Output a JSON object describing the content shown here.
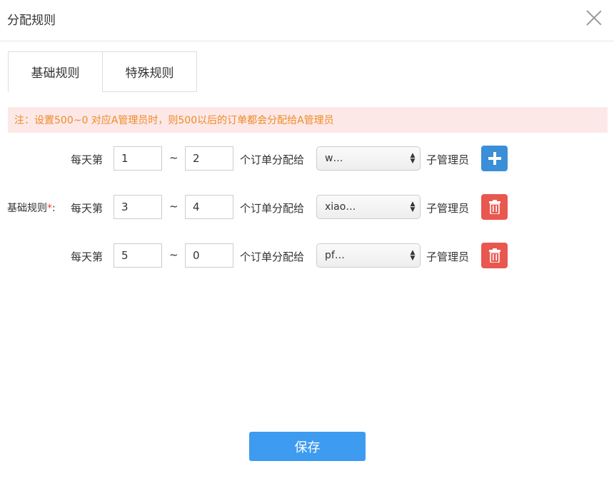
{
  "modal": {
    "title": "分配规则"
  },
  "tabs": [
    {
      "label": "基础规则",
      "active": true
    },
    {
      "label": "特殊规则",
      "active": false
    }
  ],
  "notice": "注：设置500~0 对应A管理员时，则500以后的订单都会分配给A管理员",
  "rules": {
    "label": "基础规则",
    "required_mark": "*",
    "label_colon": ":",
    "prefix": "每天第",
    "tilde": "~",
    "middle": "个订单分配给",
    "suffix": "子管理员",
    "rows": [
      {
        "from": "1",
        "to": "2",
        "admin": "w…",
        "action": "add"
      },
      {
        "from": "3",
        "to": "4",
        "admin": "xiao…",
        "action": "delete"
      },
      {
        "from": "5",
        "to": "0",
        "admin": "pf…",
        "action": "delete"
      }
    ]
  },
  "save_label": "保存",
  "icons": {
    "add": "plus-icon",
    "delete": "trash-icon",
    "close": "close-icon",
    "select": "select-arrows-icon"
  },
  "colors": {
    "accent": "#3d9bf0",
    "add": "#3a8fd8",
    "delete": "#e8584f",
    "notice_text": "#f08a24",
    "notice_bg": "#fde8e8"
  }
}
